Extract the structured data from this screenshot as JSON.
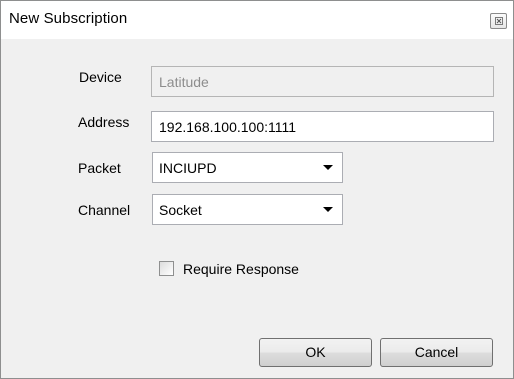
{
  "window": {
    "title": "New Subscription"
  },
  "form": {
    "device": {
      "label": "Device",
      "value": "Latitude"
    },
    "address": {
      "label": "Address",
      "value": "192.168.100.100:1111"
    },
    "packet": {
      "label": "Packet",
      "selected": "INCIUPD"
    },
    "channel": {
      "label": "Channel",
      "selected": "Socket"
    },
    "require_response": {
      "label": "Require Response",
      "checked": false
    }
  },
  "buttons": {
    "ok": "OK",
    "cancel": "Cancel"
  },
  "icons": {
    "close": "close-icon",
    "dropdown": "chevron-down-icon"
  }
}
